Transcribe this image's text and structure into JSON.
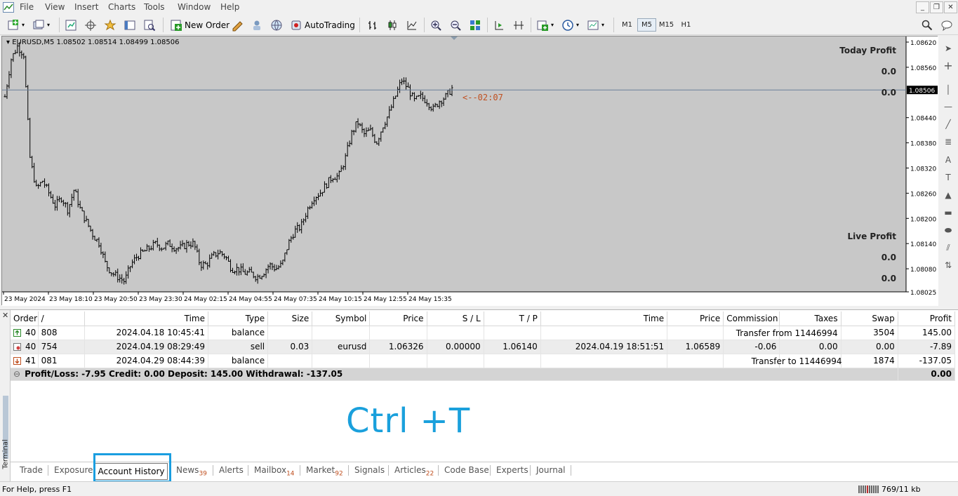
{
  "menu": [
    "File",
    "View",
    "Insert",
    "Charts",
    "Tools",
    "Window",
    "Help"
  ],
  "toolbar": {
    "new_order": "New Order",
    "autotrading": "AutoTrading",
    "timeframes": [
      "M1",
      "M5",
      "M15",
      "H1"
    ],
    "active_timeframe": "M5"
  },
  "chart": {
    "header": "EURUSD,M5  1.08502 1.08514 1.08499 1.08506",
    "today_profit_label": "Today Profit",
    "today_profit_value_1": "0.0",
    "today_profit_value_2": "0.0",
    "live_profit_label": "Live Profit",
    "live_profit_value_1": "0.0",
    "live_profit_value_2": "0.0",
    "countdown": "<--02:07",
    "current_price": "1.08506",
    "price_labels": [
      "1.08620",
      "1.08560",
      "1.08506",
      "1.08440",
      "1.08380",
      "1.08320",
      "1.08260",
      "1.08200",
      "1.08140",
      "1.08080",
      "1.08025"
    ],
    "time_labels": [
      "23 May 2024",
      "23 May 18:10",
      "23 May 20:50",
      "23 May 23:30",
      "24 May 02:15",
      "24 May 04:55",
      "24 May 07:35",
      "24 May 10:15",
      "24 May 12:55",
      "24 May 15:35"
    ]
  },
  "chart_data": {
    "type": "ohlc",
    "symbol": "EURUSD",
    "timeframe": "M5",
    "ylim": [
      1.08025,
      1.0862
    ],
    "last": {
      "open": 1.08502,
      "high": 1.08514,
      "low": 1.08499,
      "close": 1.08506
    },
    "close_path": [
      1.0849,
      1.0858,
      1.0861,
      1.0859,
      1.0834,
      1.0827,
      1.0829,
      1.0826,
      1.0823,
      1.0825,
      1.0822,
      1.0827,
      1.0822,
      1.0819,
      1.0816,
      1.0814,
      1.0809,
      1.0807,
      1.0806,
      1.0805,
      1.0809,
      1.0811,
      1.0812,
      1.0813,
      1.0814,
      1.0813,
      1.0814,
      1.0813,
      1.0813,
      1.0814,
      1.0814,
      1.0809,
      1.0809,
      1.0811,
      1.0812,
      1.0811,
      1.0808,
      1.0808,
      1.0807,
      1.0807,
      1.0806,
      1.0807,
      1.0809,
      1.0808,
      1.0809,
      1.0814,
      1.0817,
      1.0818,
      1.0822,
      1.0825,
      1.0826,
      1.0828,
      1.083,
      1.083,
      1.0834,
      1.084,
      1.0843,
      1.084,
      1.0841,
      1.0838,
      1.0842,
      1.0845,
      1.0849,
      1.0853,
      1.0851,
      1.0848,
      1.0849,
      1.0848,
      1.0846,
      1.0848,
      1.0849,
      1.0851
    ]
  },
  "terminal": {
    "side_label": "Terminal",
    "columns": [
      "Order",
      "/",
      "Time",
      "Type",
      "Size",
      "Symbol",
      "Price",
      "S / L",
      "T / P",
      "Time",
      "Price",
      "Commission",
      "Taxes",
      "Swap",
      "Profit"
    ],
    "rows": [
      {
        "order": "40",
        "order2": "808",
        "time": "2024.04.18 10:45:41",
        "type": "balance",
        "comment": "Transfer from 11446994",
        "swap": "3504",
        "profit": "145.00",
        "icon": "deposit"
      },
      {
        "order": "40",
        "order2": "754",
        "time": "2024.04.19 08:29:49",
        "type": "sell",
        "size": "0.03",
        "symbol": "eurusd",
        "price": "1.06326",
        "sl": "0.00000",
        "tp": "1.06140",
        "close_time": "2024.04.19 18:51:51",
        "close_price": "1.06589",
        "commission": "-0.06",
        "taxes": "0.00",
        "swap": "0.00",
        "profit": "-7.89",
        "icon": "sell"
      },
      {
        "order": "41",
        "order2": "081",
        "time": "2024.04.29 08:44:39",
        "type": "balance",
        "comment": "Transfer to 11446994",
        "swap": "1874",
        "profit": "-137.05",
        "icon": "withdraw"
      }
    ],
    "summary": "Profit/Loss: -7.95  Credit: 0.00  Deposit: 145.00  Withdrawal: -137.05",
    "summary_total": "0.00",
    "overlay_text": "Ctrl +T",
    "tabs": [
      {
        "label": "Trade"
      },
      {
        "label": "Exposure"
      },
      {
        "label": "Account History"
      },
      {
        "label": "News",
        "count": "39"
      },
      {
        "label": "Alerts"
      },
      {
        "label": "Mailbox",
        "count": "14"
      },
      {
        "label": "Market",
        "count": "92"
      },
      {
        "label": "Signals"
      },
      {
        "label": "Articles",
        "count": "22"
      },
      {
        "label": "Code Base"
      },
      {
        "label": "Experts"
      },
      {
        "label": "Journal"
      }
    ]
  },
  "status": {
    "help": "For Help, press F1",
    "traffic": "769/11 kb"
  }
}
